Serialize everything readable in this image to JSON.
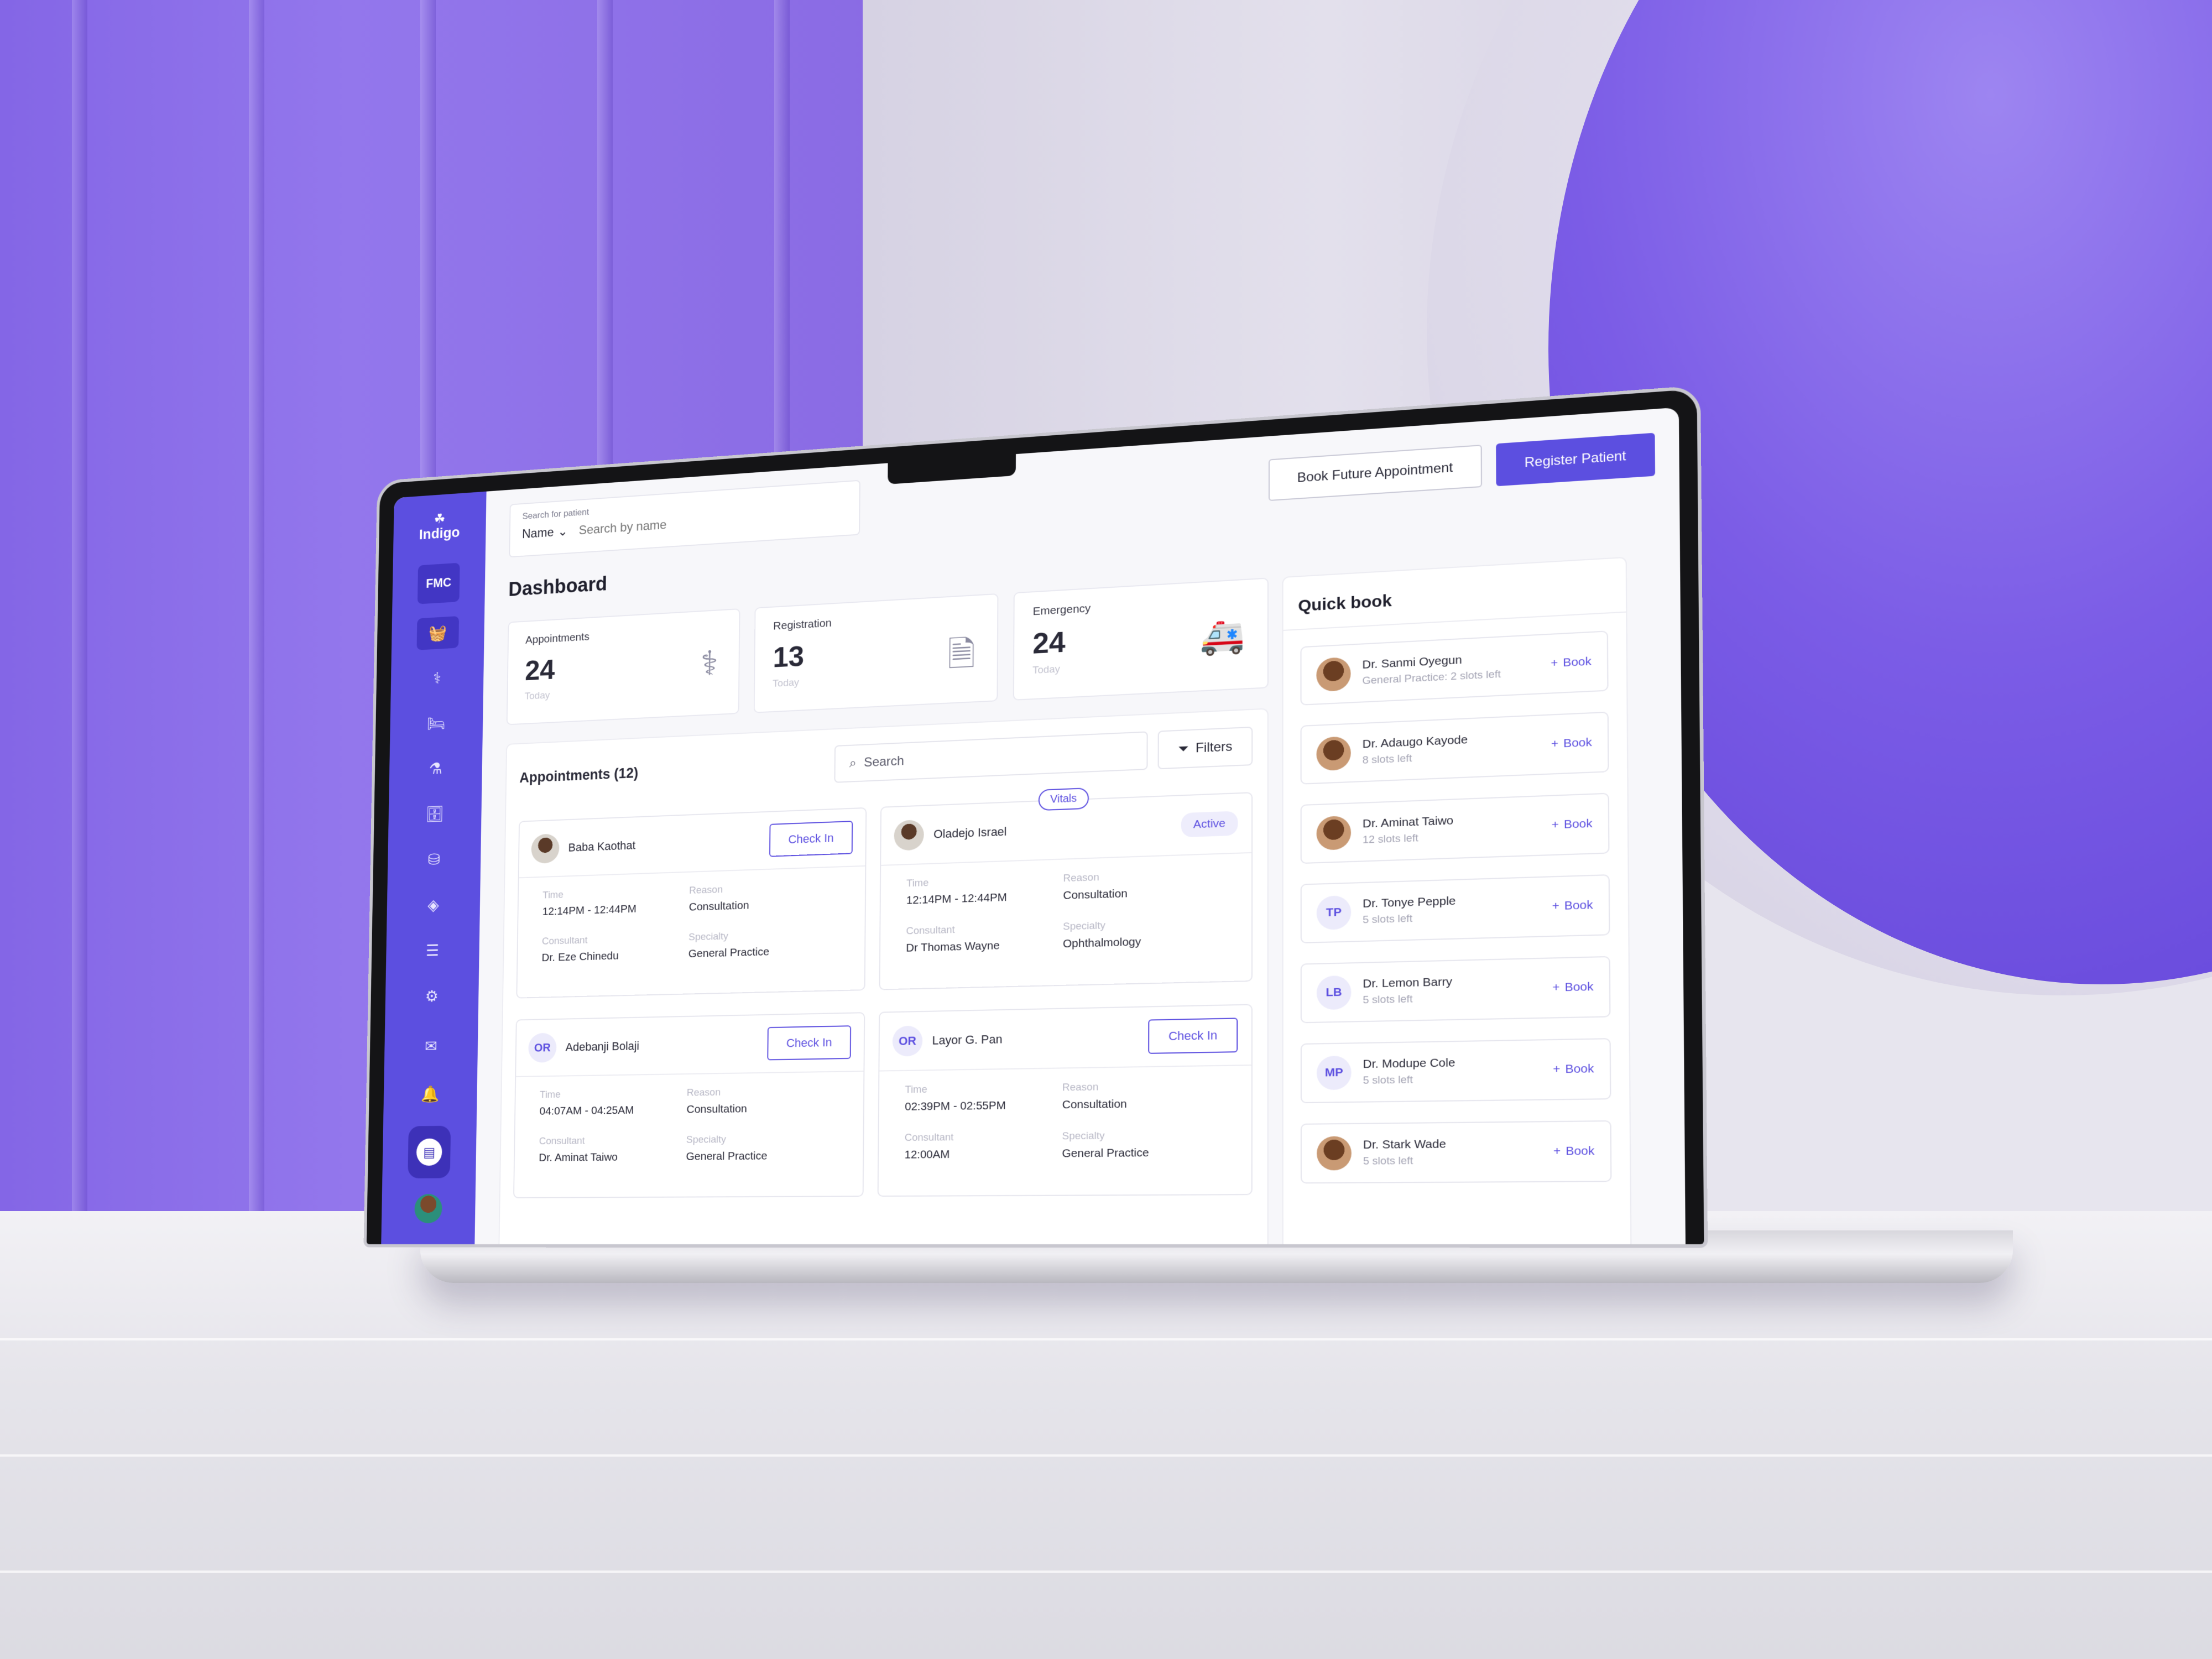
{
  "app": {
    "logo_text": "Indigo",
    "org_badge": "FMC"
  },
  "sidebar": {
    "nav": [
      {
        "icon": "cart-icon",
        "glyph": "🧺"
      },
      {
        "icon": "stethoscope-icon",
        "glyph": "⚕"
      },
      {
        "icon": "bed-icon",
        "glyph": "🛏"
      },
      {
        "icon": "vial-icon",
        "glyph": "⚗"
      },
      {
        "icon": "archive-icon",
        "glyph": "🗄"
      },
      {
        "icon": "coins-icon",
        "glyph": "⛁"
      },
      {
        "icon": "layers-icon",
        "glyph": "◈"
      },
      {
        "icon": "server-icon",
        "glyph": "☰"
      },
      {
        "icon": "gear-icon",
        "glyph": "⚙"
      }
    ],
    "bottom": [
      {
        "icon": "inbox-icon",
        "glyph": "✉"
      },
      {
        "icon": "bell-icon",
        "glyph": "🔔"
      }
    ]
  },
  "header": {
    "search_label": "Search for patient",
    "search_by": "Name",
    "search_placeholder": "Search by name",
    "book_future_label": "Book Future Appointment",
    "register_label": "Register Patient"
  },
  "page_title": "Dashboard",
  "stats": [
    {
      "label": "Appointments",
      "value": "24",
      "sub": "Today",
      "icon": "doctor-icon"
    },
    {
      "label": "Registration",
      "value": "13",
      "sub": "Today",
      "icon": "document-icon"
    },
    {
      "label": "Emergency",
      "value": "24",
      "sub": "Today",
      "icon": "ambulance-icon"
    }
  ],
  "appointments": {
    "title": "Appointments (12)",
    "search_placeholder": "Search",
    "filters_label": "Filters",
    "field_labels": {
      "time": "Time",
      "reason": "Reason",
      "consultant": "Consultant",
      "specialty": "Specialty"
    },
    "items": [
      {
        "name": "Baba Kaothat",
        "initials": "",
        "action": "Check In",
        "status": "",
        "vitals": "",
        "time": "12:14PM - 12:44PM",
        "reason": "Consultation",
        "consultant": "Dr. Eze Chinedu",
        "specialty": "General Practice"
      },
      {
        "name": "Oladejo Israel",
        "initials": "",
        "action": "",
        "status": "Active",
        "vitals": "Vitals",
        "time": "12:14PM - 12:44PM",
        "reason": "Consultation",
        "consultant": "Dr Thomas Wayne",
        "specialty": "Ophthalmology"
      },
      {
        "name": "Adebanji Bolaji",
        "initials": "OR",
        "action": "Check In",
        "status": "",
        "vitals": "",
        "time": "04:07AM - 04:25AM",
        "reason": "Consultation",
        "consultant": "Dr. Aminat Taiwo",
        "specialty": "General Practice"
      },
      {
        "name": "Layor G. Pan",
        "initials": "OR",
        "action": "Check In",
        "status": "",
        "vitals": "",
        "time": "02:39PM - 02:55PM",
        "reason": "Consultation",
        "consultant": "12:00AM",
        "specialty": "General Practice"
      }
    ]
  },
  "quick_book": {
    "title": "Quick book",
    "book_label": "Book",
    "doctors": [
      {
        "name": "Dr. Sanmi Oyegun",
        "slots": "General Practice: 2 slots left",
        "initials": ""
      },
      {
        "name": "Dr. Adaugo Kayode",
        "slots": "8 slots left",
        "initials": ""
      },
      {
        "name": "Dr. Aminat Taiwo",
        "slots": "12 slots left",
        "initials": ""
      },
      {
        "name": "Dr. Tonye Pepple",
        "slots": "5 slots left",
        "initials": "TP"
      },
      {
        "name": "Dr. Lemon Barry",
        "slots": "5 slots left",
        "initials": "LB"
      },
      {
        "name": "Dr. Modupe Cole",
        "slots": "5 slots left",
        "initials": "MP"
      },
      {
        "name": "Dr. Stark Wade",
        "slots": "5 slots left",
        "initials": ""
      }
    ]
  },
  "colors": {
    "accent": "#5c4fe0",
    "accent_dark": "#4236c4",
    "background_purple": "#8466e6"
  }
}
